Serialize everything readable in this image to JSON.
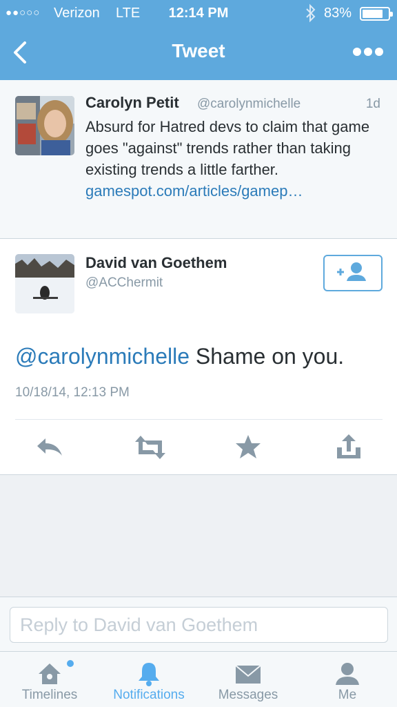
{
  "colors": {
    "accent": "#5ea9dd",
    "link": "#2b7bb9",
    "muted": "#8899a6"
  },
  "status_bar": {
    "signal": "●●○○○",
    "carrier": "Verizon",
    "network": "LTE",
    "time": "12:14 PM",
    "bluetooth_icon": "bluetooth-icon",
    "battery": "83%",
    "battery_level": 0.83
  },
  "nav": {
    "title": "Tweet",
    "back_icon": "chevron-left-icon",
    "more_icon": "more-dots-icon"
  },
  "parent_tweet": {
    "name": "Carolyn Petit",
    "handle": "@carolynmichelle",
    "time": "1d",
    "text": "Absurd for Hatred devs to claim that game goes \"against\" trends rather than taking existing trends a little farther.",
    "link": "gamespot.com/articles/gamep…"
  },
  "main_tweet": {
    "name": "David van Goethem",
    "handle": "@ACChermit",
    "follow_icon": "follow-user-icon",
    "mention": "@carolynmichelle",
    "text": " Shame on you.",
    "date": "10/18/14, 12:13 PM"
  },
  "actions": [
    {
      "icon": "reply-icon"
    },
    {
      "icon": "retweet-icon"
    },
    {
      "icon": "favorite-star-icon"
    },
    {
      "icon": "share-icon"
    }
  ],
  "reply": {
    "placeholder": "Reply to David van Goethem"
  },
  "tabs": [
    {
      "label": "Timelines",
      "icon": "home-icon",
      "active": false
    },
    {
      "label": "Notifications",
      "icon": "bell-icon",
      "active": true
    },
    {
      "label": "Messages",
      "icon": "envelope-icon",
      "active": false
    },
    {
      "label": "Me",
      "icon": "person-icon",
      "active": false
    }
  ]
}
